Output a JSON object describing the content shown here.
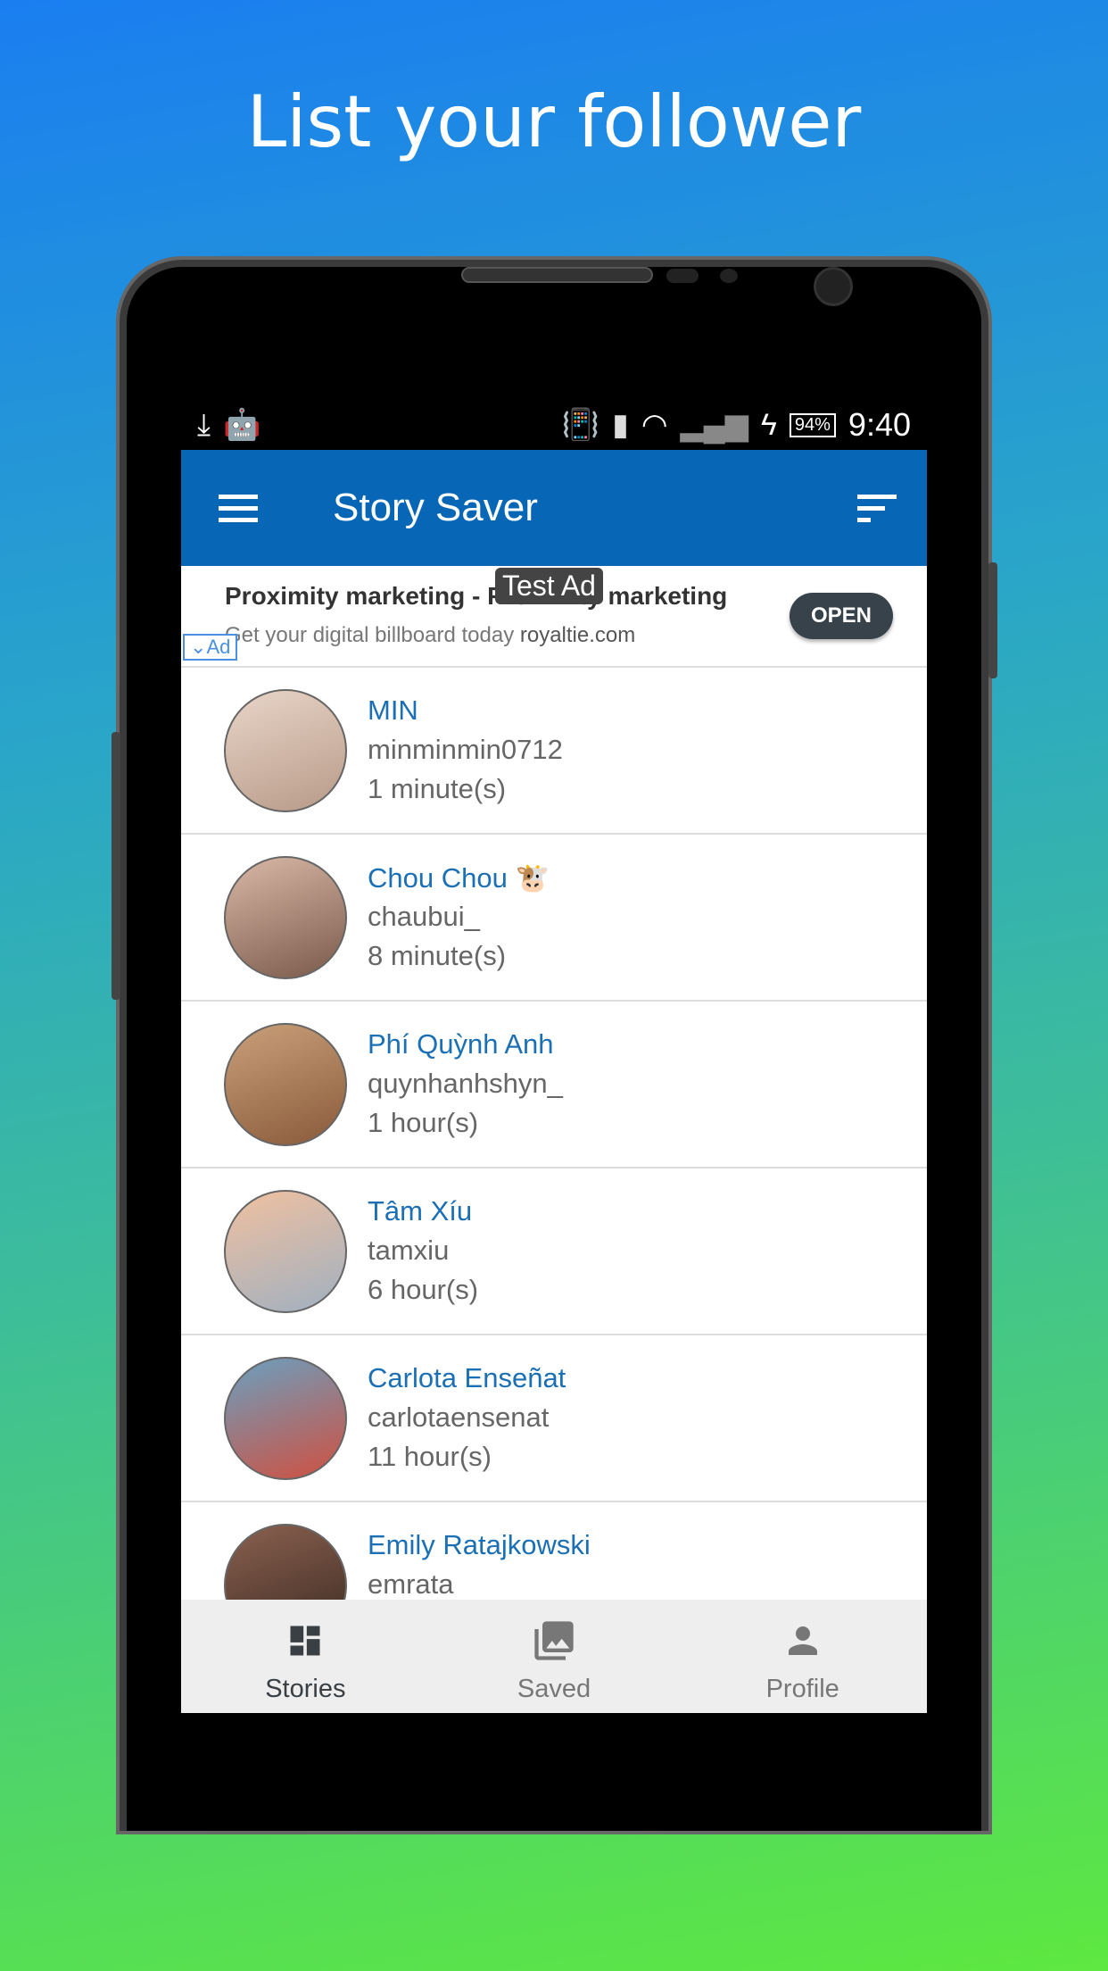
{
  "headline": "List your follower",
  "status": {
    "time": "9:40",
    "battery": "94%"
  },
  "appbar": {
    "title": "Story Saver"
  },
  "ad": {
    "title": "Proximity marketing - Proximity marketing",
    "subtitle": "Get your digital billboard today",
    "domain": "royaltie.com",
    "test_label": "Test Ad",
    "open_label": "OPEN",
    "badge": "Ad"
  },
  "followers": [
    {
      "name": "MIN",
      "username": "minminmin0712",
      "time": "1 minute(s)"
    },
    {
      "name": "Chou Chou 🐮",
      "username": "chaubui_",
      "time": "8 minute(s)"
    },
    {
      "name": "Phí Quỳnh Anh",
      "username": "quynhanhshyn_",
      "time": "1 hour(s)"
    },
    {
      "name": "Tâm Xíu",
      "username": "tamxiu",
      "time": "6 hour(s)"
    },
    {
      "name": "Carlota Enseñat",
      "username": "carlotaensenat",
      "time": "11 hour(s)"
    },
    {
      "name": "Emily Ratajkowski",
      "username": "emrata",
      "time": ""
    }
  ],
  "nav": [
    {
      "label": "Stories",
      "icon": "dashboard-icon",
      "active": true
    },
    {
      "label": "Saved",
      "icon": "photo-library-icon"
    },
    {
      "label": "Profile",
      "icon": "person-icon"
    }
  ],
  "colors": {
    "appbar": "#0766b5",
    "name": "#1a6fb5"
  }
}
